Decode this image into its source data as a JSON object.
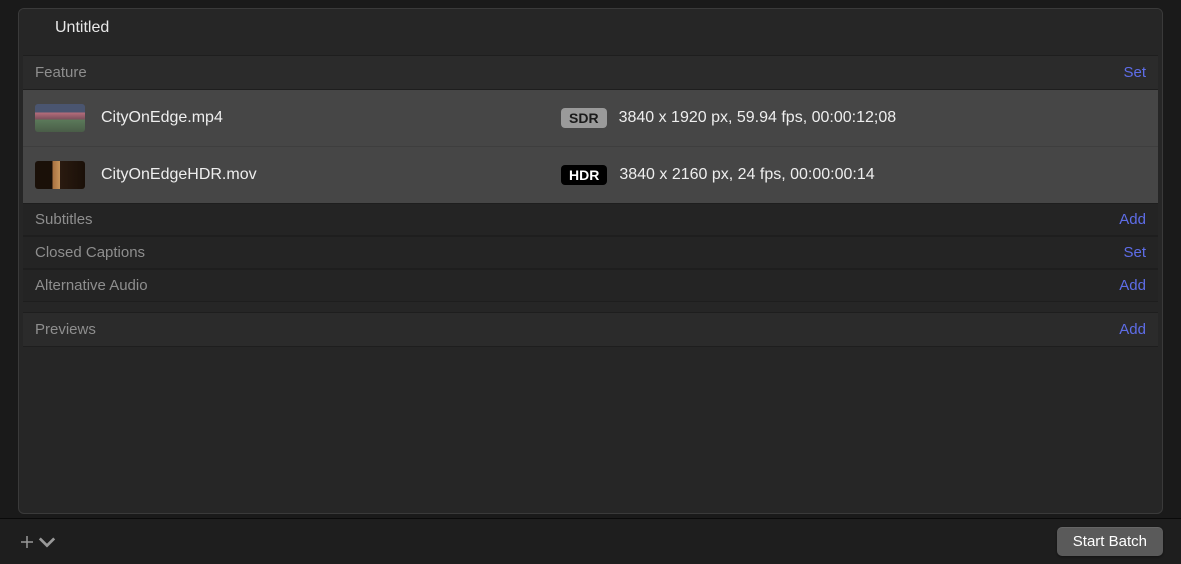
{
  "panel": {
    "title": "Untitled"
  },
  "sections": {
    "feature": {
      "label": "Feature",
      "action": "Set",
      "rows": [
        {
          "name": "CityOnEdge.mp4",
          "badge": "SDR",
          "meta": "3840 x 1920 px, 59.94 fps, 00:00:12;08"
        },
        {
          "name": "CityOnEdgeHDR.mov",
          "badge": "HDR",
          "meta": "3840 x 2160 px, 24 fps, 00:00:00:14"
        }
      ]
    },
    "subtitles": {
      "label": "Subtitles",
      "action": "Add"
    },
    "closedCaptions": {
      "label": "Closed Captions",
      "action": "Set"
    },
    "altAudio": {
      "label": "Alternative Audio",
      "action": "Add"
    },
    "previews": {
      "label": "Previews",
      "action": "Add"
    }
  },
  "footer": {
    "startBatch": "Start Batch"
  }
}
